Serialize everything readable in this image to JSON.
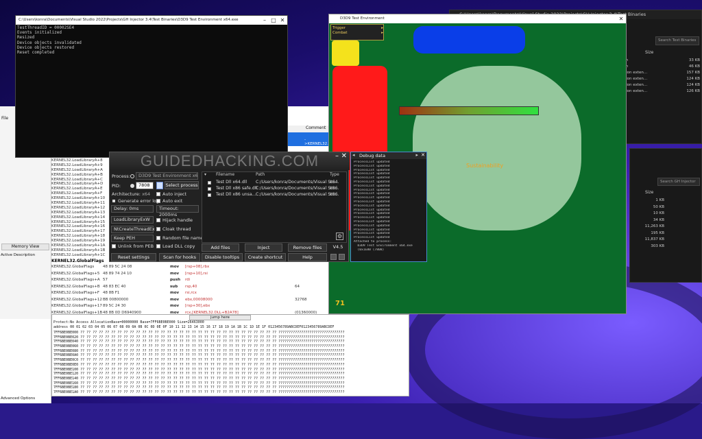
{
  "console": {
    "title": "C:\\Users\\konra\\Documents\\Visual Studio 2022\\Projects\\GH Injector 3.4\\Test Binaries\\D3D9 Test Environment x64.exe",
    "lines": [
      "TestThreadID = 00002SE4",
      "Events initialized",
      "Resized",
      "Device objects invalidated",
      "Device objects restored",
      "Reset completed"
    ]
  },
  "game": {
    "title": "D3D9 Test Environment",
    "menu": [
      "Trigger",
      "Combat"
    ],
    "status_text": "Sustainability",
    "counter": "71"
  },
  "explorer_top": {
    "title": "C:\\Users\\konra\\Documents\\Visual Studio 2022\\Projects\\GH Injector 3.4\\Test Binaries",
    "search_placeholder": "Search Test Binaries",
    "size_header": "Size",
    "rows": [
      {
        "name": "m",
        "size": "33 KB"
      },
      {
        "name": "m",
        "size": "46 KB"
      },
      {
        "name": "tion exten...",
        "size": "157 KB"
      },
      {
        "name": "tion exten...",
        "size": "124 KB"
      },
      {
        "name": "tion exten...",
        "size": "124 KB"
      },
      {
        "name": "tion exten...",
        "size": "126 KB"
      }
    ]
  },
  "explorer_bottom": {
    "search_placeholder": "Search GH Injector",
    "size_header": "Size",
    "sizes": [
      "1 KB",
      "50 KB",
      "10 KB",
      "34 KB",
      "11,263 KB",
      "195 KB",
      "11,837 KB",
      "303 KB"
    ]
  },
  "debugger": {
    "comment_header": "Comment",
    "comment_highlight": "->KERNEL32.BAS",
    "memory_view_label": "Memory View",
    "active_label": "Active   Description",
    "advanced_label": "Advanced Options",
    "module_header": "KERNEL32.GlobalFlags",
    "left_rows": [
      "KERNEL32.LoadLibraryA+8",
      "KERNEL32.LoadLibraryA+9",
      "KERNEL32.LoadLibraryA+A",
      "KERNEL32.LoadLibraryA+B",
      "KERNEL32.LoadLibraryA+C",
      "KERNEL32.LoadLibraryA+D",
      "KERNEL32.LoadLibraryA+E",
      "KERNEL32.LoadLibraryA+F",
      "KERNEL32.LoadLibraryA+10",
      "KERNEL32.LoadLibraryA+11",
      "KERNEL32.LoadLibraryA+12",
      "KERNEL32.LoadLibraryA+13",
      "KERNEL32.LoadLibraryA+14",
      "KERNEL32.LoadLibraryA+15",
      "KERNEL32.LoadLibraryA+16",
      "KERNEL32.LoadLibraryA+17",
      "KERNEL32.LoadLibraryA+18",
      "KERNEL32.LoadLibraryA+19",
      "KERNEL32.LoadLibraryA+1A",
      "KERNEL32.LoadLibraryA+1B",
      "KERNEL32.LoadLibraryA+1C"
    ],
    "code_rows": [
      {
        "addr": "KERNEL32.GlobalFlags",
        "bytes": "48 89 5C 24 08",
        "op": "mov",
        "arg": "[rsp+08],rbx",
        "c": ""
      },
      {
        "addr": "KERNEL32.GlobalFlags+5",
        "bytes": "48 89 74 24 10",
        "op": "mov",
        "arg": "[rsp+10],rsi",
        "c": ""
      },
      {
        "addr": "KERNEL32.GlobalFlags+A",
        "bytes": "57",
        "op": "push",
        "arg": "rdi",
        "c": ""
      },
      {
        "addr": "KERNEL32.GlobalFlags+B",
        "bytes": "48 83 EC 40",
        "op": "sub",
        "arg": "rsp,40",
        "c": "64"
      },
      {
        "addr": "KERNEL32.GlobalFlags+F",
        "bytes": "48 8B F1",
        "op": "mov",
        "arg": "rsi,rcx",
        "c": ""
      },
      {
        "addr": "KERNEL32.GlobalFlags+12",
        "bytes": "BB 00800000",
        "op": "mov",
        "arg": "ebx,00008000",
        "c": "32768"
      },
      {
        "addr": "KERNEL32.GlobalFlags+17",
        "bytes": "89 5C 24 30",
        "op": "mov",
        "arg": "[rsp+30],ebx",
        "c": ""
      },
      {
        "addr": "KERNEL32.GlobalFlags+1B",
        "bytes": "48 8B 0D D6940900",
        "op": "mov",
        "arg": "rcx,[KERNEL32.DLL+B2A78]",
        "c": "(01360000)"
      },
      {
        "addr": "KERNEL32.GlobalFlags+22",
        "bytes": "48 FF 15 01770600",
        "op": "call",
        "arg": "qword ptr [KERNEL32.DLL+1B1C58]",
        "c": "->ntdll.RtlLockH"
      }
    ],
    "jump_label": "jump here",
    "hex_header": "Protect:No Access  AllocationBase=00000000 Base=7FF6BE0BE000 Size=26463000",
    "hex_cols": "address  00 01 02 03 04 05 06 07 08 09 0A 0B 0C 0D 0E 0F 10 11 12 13 14 15 16 17 18 19 1A 1B 1C 1D 1E 1F 0123456789ABCDEF0123456789ABCDEF",
    "hex_addrs": [
      "7FF6BE0BE000",
      "7FF6BE0BE020",
      "7FF6BE0BE040",
      "7FF6BE0BE060",
      "7FF6BE0BE080",
      "7FF6BE0BE0A0",
      "7FF6BE0BE0C0",
      "7FF6BE0BE0E0",
      "7FF6BE0BE100",
      "7FF6BE0BE120",
      "7FF6BE0BE140",
      "7FF6BE0BE160",
      "7FF6BE0BE180",
      "7FF6BE0BE1A0"
    ],
    "hex_fill": "?? ?? ?? ?? ?? ?? ?? ?? ?? ?? ?? ?? ?? ?? ?? ?? ?? ?? ?? ?? ?? ?? ?? ?? ?? ?? ?? ?? ?? ?? ?? ?? ????????????????????????????????"
  },
  "injector": {
    "logo": "GUIDEDHACKING.COM",
    "process_label": "Process:",
    "process_value": "D3D9 Test Environment x64.exe",
    "pid_label": "PID:",
    "pid_value": "7808",
    "select_process": "Select process",
    "arch_label": "Architecture:",
    "arch_value": "x64",
    "auto_inject": "Auto inject",
    "gen_error_log": "Generate error log",
    "auto_exit": "Auto exit",
    "delay_label": "Delay: 0ms",
    "timeout_label": "Timeout: 2000ms",
    "method": "LoadLibraryExW",
    "launch": "NtCreateThreadEx",
    "peh": "Keep PEH",
    "unlink": "Unlink from PEB",
    "hijack": "Hijack handle",
    "cloak": "Cloak thread",
    "random": "Random file name",
    "load_copy": "Load DLL copy",
    "col_filename": "Filename",
    "col_path": "Path",
    "col_type": "Type",
    "files": [
      {
        "name": "Test Dll x64.dll",
        "path": "C:/Users/konra/Documents/Visual Stu...",
        "type": "x64"
      },
      {
        "name": "Test Dll x86 safe.dll",
        "path": "C:/Users/konra/Documents/Visual Stu...",
        "type": "x86"
      },
      {
        "name": "Test Dll x86 unsa...",
        "path": "C:/Users/konra/Documents/Visual Stu...",
        "type": "x86"
      }
    ],
    "add_files": "Add files",
    "inject": "Inject",
    "remove_files": "Remove files",
    "version": "V4.5",
    "reset_settings": "Reset settings",
    "scan_hooks": "Scan for hooks",
    "disable_tooltips": "Disable tooltips",
    "create_shortcut": "Create shortcut",
    "help": "Help"
  },
  "debug": {
    "title": "Debug data",
    "lines": [
      "ProcessList updated",
      "ProcessList updated",
      "ProcessList updated",
      "ProcessList updated",
      "ProcessList updated",
      "ProcessList updated",
      "ProcessList updated",
      "ProcessList updated",
      "ProcessList updated",
      "ProcessList updated",
      "ProcessList updated",
      "ProcessList updated",
      "ProcessList updated",
      "ProcessList updated",
      "ProcessList updated",
      "ProcessList updated",
      "ProcessList updated",
      "ProcessList updated",
      "ProcessList updated",
      "ProcessList updated",
      "Attached to process:",
      "  D3D9 Test Environment x64.exe",
      "  (0x1E80 (7808)"
    ]
  },
  "colors": {
    "game_bg": "#0b6b2a",
    "blue": "#0a3ee8",
    "red": "#ff1a1a",
    "yellow": "#f4e21c",
    "circle": "#94c79c",
    "accent": "#f0a020"
  }
}
